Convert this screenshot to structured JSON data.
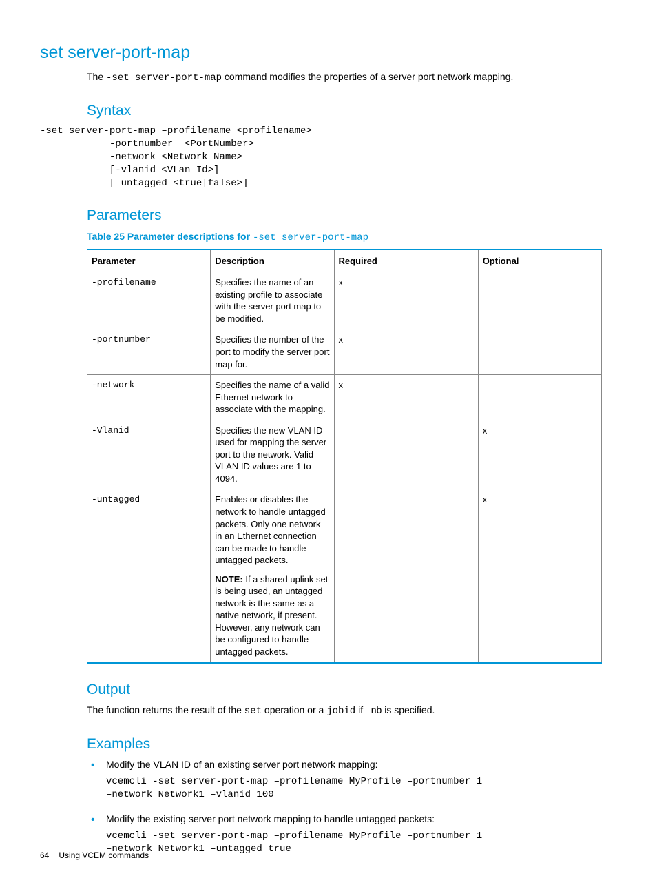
{
  "title": "set server-port-map",
  "intro_pre": "The ",
  "intro_code": "-set server-port-map",
  "intro_post": " command modifies the properties of a server port network mapping.",
  "syntax": {
    "heading": "Syntax",
    "code": "-set server-port-map –profilename <profilename>\n            -portnumber  <PortNumber>\n            -network <Network Name>\n            [-vlanid <VLan Id>]\n            [–untagged <true|false>]"
  },
  "parameters": {
    "heading": "Parameters",
    "caption_prefix": "Table 25 Parameter descriptions for ",
    "caption_code": "-set server-port-map",
    "headers": {
      "param": "Parameter",
      "desc": "Description",
      "req": "Required",
      "opt": "Optional"
    },
    "rows": [
      {
        "param": "-profilename",
        "desc": "Specifies the name of an existing profile to associate with the server port map to be modified.",
        "req": "x",
        "opt": ""
      },
      {
        "param": "-portnumber",
        "desc": "Specifies the number of the port to modify the server port map for.",
        "req": "x",
        "opt": ""
      },
      {
        "param": "-network",
        "desc": "Specifies the name of a valid Ethernet network to associate with the mapping.",
        "req": "x",
        "opt": ""
      },
      {
        "param": "-Vlanid",
        "desc": "Specifies the new VLAN ID used for mapping the server port to the network. Valid VLAN ID values are 1 to 4094.",
        "req": "",
        "opt": "x"
      },
      {
        "param": "-untagged",
        "desc": "Enables or disables the network to handle untagged packets. Only one network in an Ethernet connection can be made to handle untagged packets.",
        "note_label": "NOTE:",
        "note_text": "If a shared uplink set is being used, an untagged network is the same as a native network, if present. However, any network can be configured to handle untagged packets.",
        "req": "",
        "opt": "x"
      }
    ]
  },
  "output": {
    "heading": "Output",
    "pre": "The function returns the result of the ",
    "code1": "set",
    "mid": " operation or a ",
    "code2": "jobid",
    "post": " if –nb is specified."
  },
  "examples": {
    "heading": "Examples",
    "items": [
      {
        "text": "Modify the VLAN ID of an existing server port network mapping:",
        "code": "vcemcli -set server-port-map –profilename MyProfile –portnumber 1\n–network Network1 –vlanid 100"
      },
      {
        "text": "Modify the existing server port network mapping to handle untagged packets:",
        "code": "vcemcli -set server-port-map –profilename MyProfile –portnumber 1\n–network Network1 –untagged true"
      }
    ]
  },
  "footer": {
    "page": "64",
    "section": "Using VCEM commands"
  }
}
